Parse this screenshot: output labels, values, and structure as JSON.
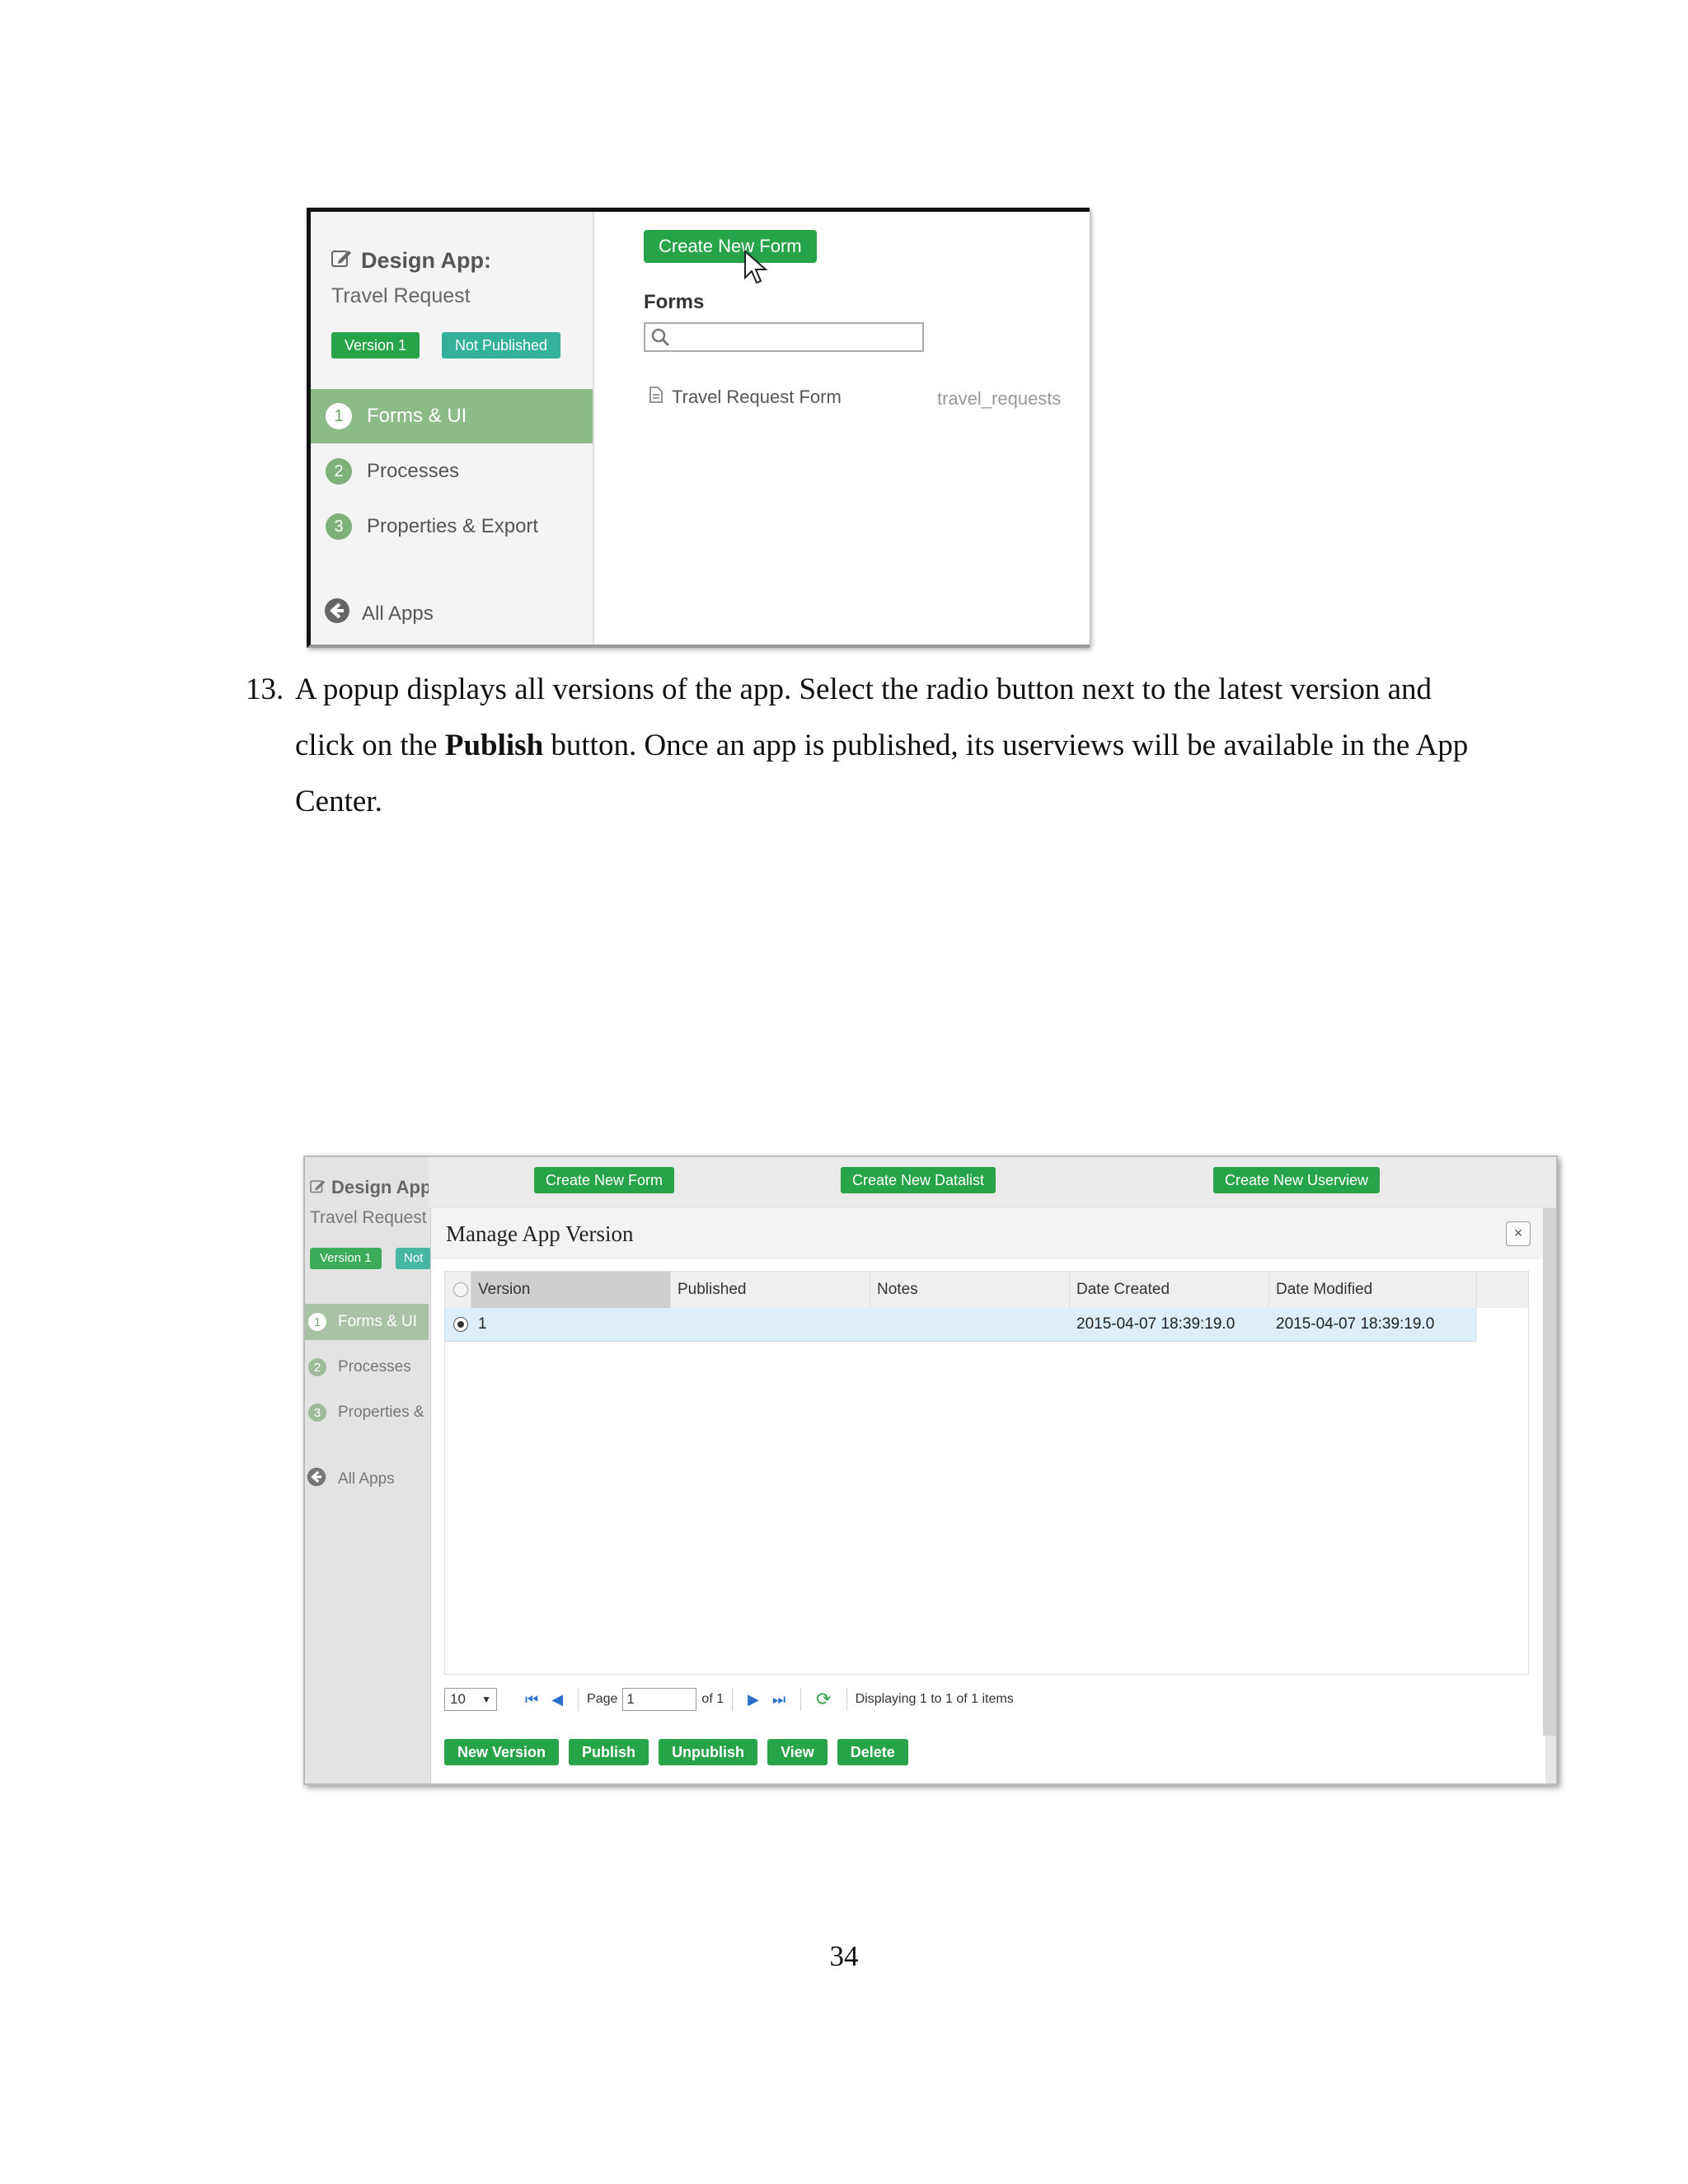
{
  "shot1": {
    "title": "Design App:",
    "subtitle": "Travel Request",
    "badge_version": "Version 1",
    "badge_status": "Not Published",
    "nav": [
      {
        "num": "1",
        "label": "Forms & UI"
      },
      {
        "num": "2",
        "label": "Processes"
      },
      {
        "num": "3",
        "label": "Properties & Export"
      }
    ],
    "all_apps": "All Apps",
    "create_button": "Create New Form",
    "forms_heading": "Forms",
    "form_row": {
      "name": "Travel Request Form",
      "table": "travel_requests"
    }
  },
  "step": {
    "number": "13.",
    "text_a": "A popup displays all versions of the app. Select the radio button next to the latest version and click on the ",
    "text_bold": "Publish",
    "text_b": " button. Once an app is published, its userviews will be available in the App Center."
  },
  "shot2": {
    "title": "Design App:",
    "subtitle": "Travel Request",
    "badge_version": "Version 1",
    "badge_status": "Not",
    "nav": [
      {
        "num": "1",
        "label": "Forms & UI"
      },
      {
        "num": "2",
        "label": "Processes"
      },
      {
        "num": "3",
        "label": "Properties &"
      }
    ],
    "all_apps": "All Apps",
    "top_buttons": [
      "Create New Form",
      "Create New Datalist",
      "Create New Userview"
    ],
    "modal_title": "Manage App Version",
    "close": "×",
    "columns": [
      "Version",
      "Published",
      "Notes",
      "Date Created",
      "Date Modified"
    ],
    "row": {
      "version": "1",
      "published": "",
      "notes": "",
      "created": "2015-04-07 18:39:19.0",
      "modified": "2015-04-07 18:39:19.0"
    },
    "pager": {
      "page_size": "10",
      "page_label": "Page",
      "page_value": "1",
      "of": "of 1",
      "display": "Displaying 1 to 1 of 1 items"
    },
    "actions": [
      "New Version",
      "Publish",
      "Unpublish",
      "View",
      "Delete"
    ]
  },
  "page_number": "34"
}
